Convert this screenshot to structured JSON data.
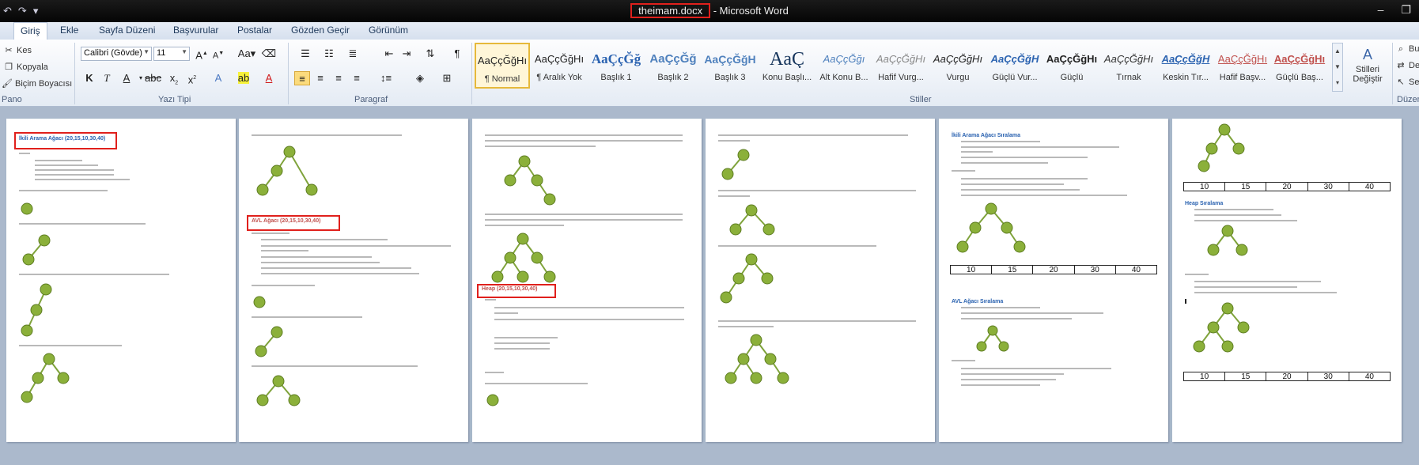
{
  "window": {
    "file_name": "theimam.docx",
    "app_name": " - Microsoft Word"
  },
  "tabs": [
    "Giriş",
    "Ekle",
    "Sayfa Düzeni",
    "Başvurular",
    "Postalar",
    "Gözden Geçir",
    "Görünüm"
  ],
  "pano": {
    "label": "Pano",
    "cut": "Kes",
    "copy": "Kopyala",
    "format_painter": "Biçim Boyacısı"
  },
  "font": {
    "label": "Yazı Tipi",
    "family": "Calibri (Gövde)",
    "size": "11"
  },
  "paragraph": {
    "label": "Paragraf"
  },
  "styles": {
    "label": "Stiller",
    "change": "Stilleri Değiştir",
    "items": [
      {
        "preview": "AaÇçĞğHı",
        "name": "¶ Normal"
      },
      {
        "preview": "AaÇçĞğHı",
        "name": "¶ Aralık Yok"
      },
      {
        "preview": "AaÇçĞğ",
        "name": "Başlık 1"
      },
      {
        "preview": "AaÇçĞğ",
        "name": "Başlık 2"
      },
      {
        "preview": "AaÇçĞğH",
        "name": "Başlık 3"
      },
      {
        "preview": "AaÇ",
        "name": "Konu Başlı..."
      },
      {
        "preview": "AaÇçĞğı",
        "name": "Alt Konu B..."
      },
      {
        "preview": "AaÇçĞğHı",
        "name": "Hafif Vurg..."
      },
      {
        "preview": "AaÇçĞğHı",
        "name": "Vurgu"
      },
      {
        "preview": "AaÇçĞğH",
        "name": "Güçlü Vur..."
      },
      {
        "preview": "AaÇçĞğHı",
        "name": "Güçlü"
      },
      {
        "preview": "AaÇçĞğHı",
        "name": "Tırnak"
      },
      {
        "preview": "AaÇçĞğH",
        "name": "Keskin Tır..."
      },
      {
        "preview": "AaÇçĞğHı",
        "name": "Hafif Başv..."
      },
      {
        "preview": "AaÇçĞğHı",
        "name": "Güçlü Baş..."
      }
    ]
  },
  "right_panel": {
    "find": "Bu",
    "replace": "De",
    "select": "Se",
    "label": "Düzen"
  },
  "pages": {
    "p1_heading": "İkili Arama Ağacı (20,15,10,30,40)",
    "p2_heading": "AVL Ağacı (20,15,10,30,40)",
    "p3_heading": "Heap (20,15,10,30,40)",
    "p5_heading1": "İkili Arama Ağacı Sıralama",
    "p5_heading2": "AVL Ağacı Sıralama",
    "p6_heading": "Heap Sıralama",
    "array_values": [
      "10",
      "15",
      "20",
      "30",
      "40"
    ]
  },
  "colors": {
    "highlight": "#e0201c",
    "heading": "#2a62b0",
    "node": "#8bb03a"
  }
}
